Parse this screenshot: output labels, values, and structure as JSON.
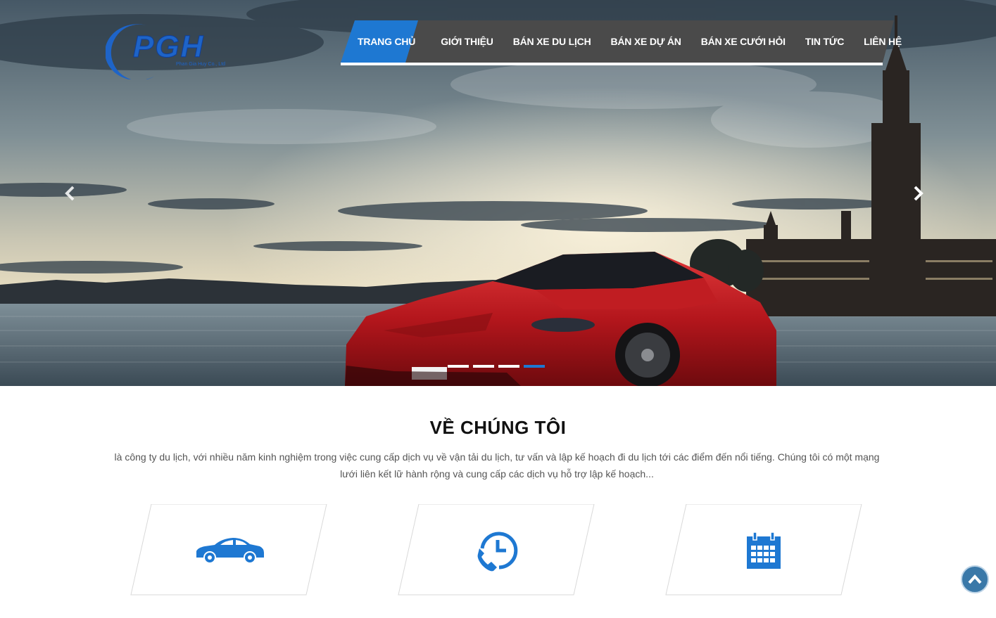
{
  "brand": {
    "logo_text": "PGH",
    "logo_subtitle": "Phan Gia Huy Co., Ltd",
    "primary_color": "#1e78d2"
  },
  "nav": {
    "items": [
      {
        "label": "TRANG CHỦ",
        "active": true
      },
      {
        "label": "GIỚI THIỆU",
        "active": false
      },
      {
        "label": "BÁN XE DU LỊCH",
        "active": false
      },
      {
        "label": "BÁN XE DỰ ÁN",
        "active": false
      },
      {
        "label": "BÁN XE CƯỚI HỎI",
        "active": false
      },
      {
        "label": "TIN TỨC",
        "active": false
      },
      {
        "label": "LIÊN HỆ",
        "active": false
      }
    ],
    "active_color": "#1e78d2",
    "bar_color": "#4a4a4a"
  },
  "slider": {
    "prev_icon": "chevron-left-icon",
    "next_icon": "chevron-right-icon",
    "slide_count": 4,
    "active_slide": 4
  },
  "about": {
    "title": "VỀ CHÚNG TÔI",
    "text": "là công ty du lịch, với nhiều năm kinh nghiệm trong việc cung cấp dịch vụ về vận tải du lịch, tư vấn và lập kế hoạch đi du lịch tới các điểm đến nổi tiếng. Chúng tôi có một mạng lưới liên kết lữ hành rộng và cung cấp các dịch vụ hỗ trợ lập kế hoạch..."
  },
  "features": [
    {
      "icon": "car-icon"
    },
    {
      "icon": "phone-clock-icon"
    },
    {
      "icon": "calendar-icon"
    }
  ],
  "back_to_top": {
    "icon": "chevron-up-icon"
  }
}
